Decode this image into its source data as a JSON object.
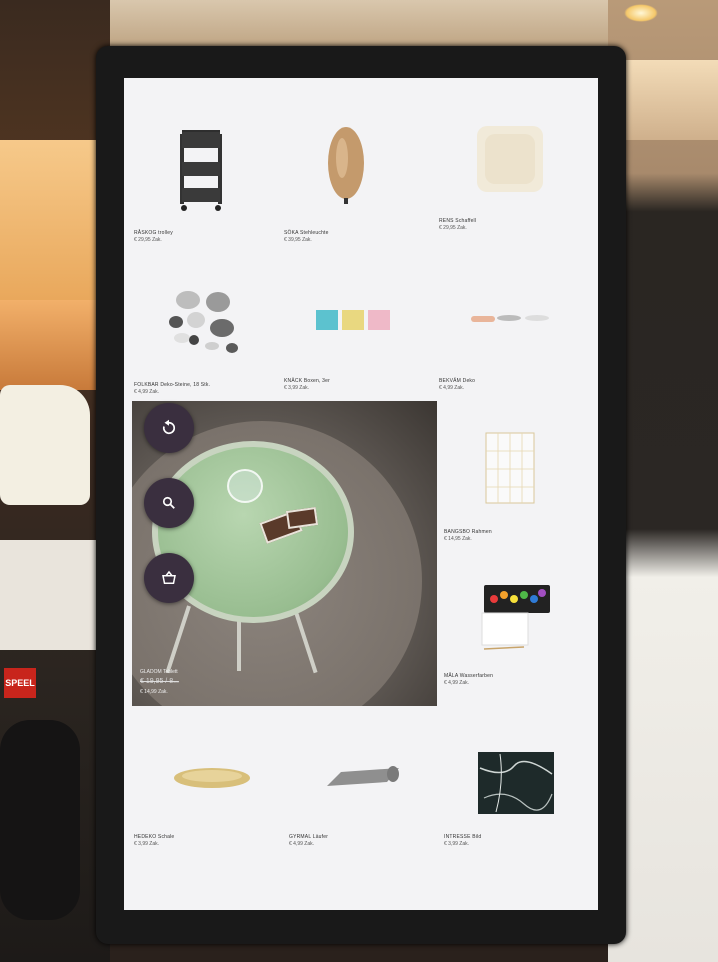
{
  "screen": {
    "products": [
      {
        "name": "RÅSKOG trolley",
        "price": "€ 29,95 Zak."
      },
      {
        "name": "SÖKA Stehleuchte",
        "price": "€ 39,95 Zak."
      },
      {
        "name": "RENS Schaffell",
        "price": "€ 29,95 Zak."
      },
      {
        "name": "FOLKBAR Deko-Steine, 18 Stk.",
        "price": "€ 4,99 Zak."
      },
      {
        "name": "KNÄCK Boxen, 3er",
        "price": "€ 3,99 Zak."
      },
      {
        "name": "BEKVÄM Deko",
        "price": "€ 4,99 Zak."
      },
      {
        "name": "BANGSBO Rahmen",
        "price": "€ 14,95 Zak."
      },
      {
        "name": "MÅLA Wasserfarben",
        "price": "€ 4,99 Zak."
      },
      {
        "name": "HEDEKO Schale",
        "price": "€ 3,99 Zak."
      },
      {
        "name": "GYRMAL Läufer",
        "price": "€ 4,99 Zak."
      },
      {
        "name": "INTRESSE Bild",
        "price": "€ 3,99 Zak."
      }
    ],
    "featured": {
      "name": "GLADOM Tablett",
      "old_price": "€ 19,95 / 8...",
      "price": "€ 14,99 Zak."
    },
    "fab_icons": [
      "refresh-icon",
      "search-icon",
      "basket-icon"
    ]
  },
  "store_sign": "SPEEL",
  "colors": {
    "fab": "#3a2f3f",
    "screen_bg": "#f3f3f5",
    "bezel": "#191919"
  }
}
